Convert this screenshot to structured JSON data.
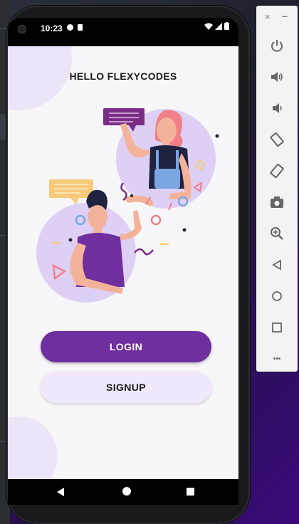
{
  "status_bar": {
    "time": "10:23"
  },
  "app": {
    "title": "HELLO FLEXYCODES",
    "login_label": "LOGIN",
    "signup_label": "SIGNUP",
    "accent_color": "#6f2f9e",
    "signup_color": "#f1e8fb"
  },
  "emulator_toolbar": {
    "close_glyph": "×",
    "minimize_glyph": "–",
    "more_glyph": "•••",
    "buttons": [
      "power-icon",
      "volume-up-icon",
      "volume-down-icon",
      "rotate-left-icon",
      "rotate-right-icon",
      "camera-icon",
      "zoom-icon",
      "back-icon",
      "home-icon",
      "overview-icon",
      "more-icon"
    ]
  },
  "nav_bar": {
    "buttons": [
      "back-icon",
      "home-icon",
      "recents-icon"
    ]
  }
}
